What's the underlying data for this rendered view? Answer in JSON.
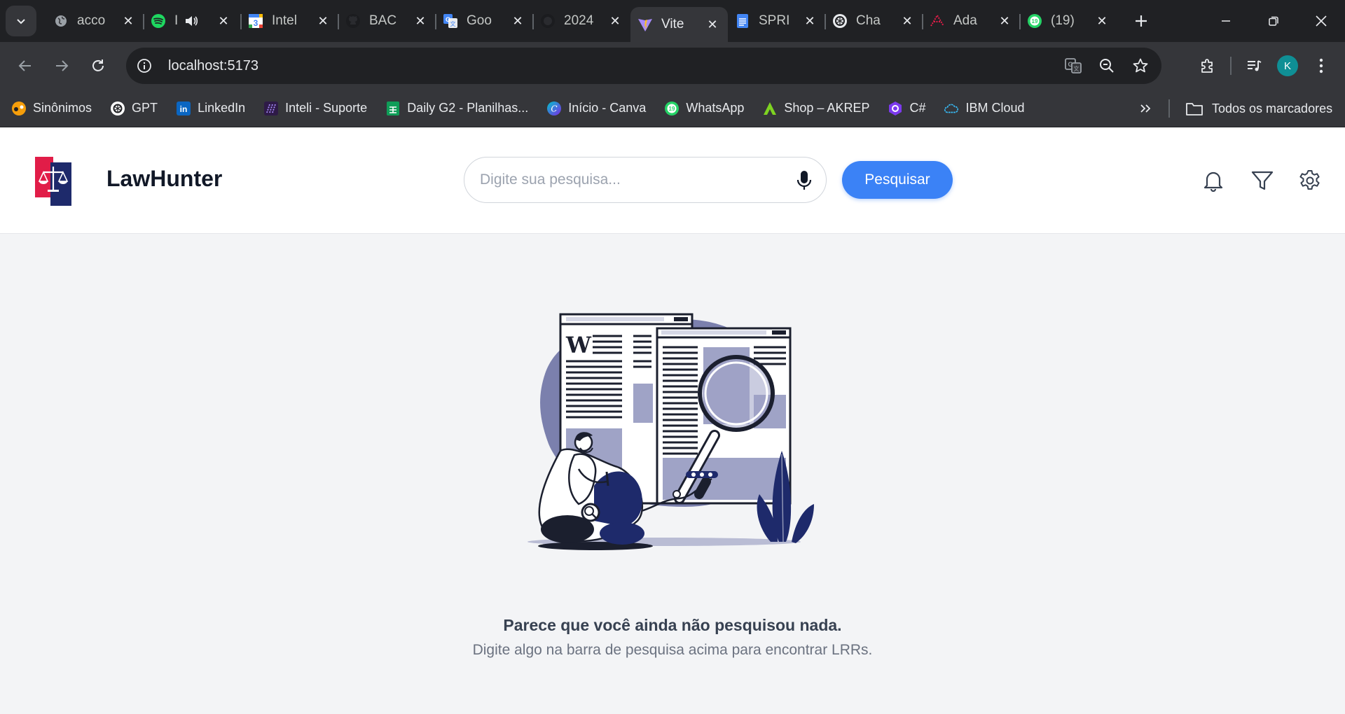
{
  "browser": {
    "tabs": [
      {
        "title": "acco",
        "icon": "globe-icon",
        "active": false
      },
      {
        "title": "I",
        "icon": "spotify-icon",
        "active": false,
        "audio": true
      },
      {
        "title": "Intel",
        "icon": "calendar-icon",
        "active": false
      },
      {
        "title": "BAC",
        "icon": "github-icon",
        "active": false
      },
      {
        "title": "Goo",
        "icon": "google-translate-icon",
        "active": false
      },
      {
        "title": "2024",
        "icon": "github-icon",
        "active": false
      },
      {
        "title": "Vite",
        "icon": "vite-icon",
        "active": true
      },
      {
        "title": "SPRI",
        "icon": "docs-icon",
        "active": false
      },
      {
        "title": "Cha",
        "icon": "chatgpt-icon",
        "active": false
      },
      {
        "title": "Ada",
        "icon": "ada-icon",
        "active": false
      },
      {
        "title": "(19)",
        "icon": "whatsapp-icon",
        "active": false
      }
    ],
    "url": "localhost:5173",
    "profile_initial": "K",
    "bookmarks": [
      {
        "label": "Sinônimos",
        "icon": "sinonimos-icon"
      },
      {
        "label": "GPT",
        "icon": "chatgpt-icon"
      },
      {
        "label": "LinkedIn",
        "icon": "linkedin-icon"
      },
      {
        "label": "Inteli - Suporte",
        "icon": "inteli-icon"
      },
      {
        "label": "Daily G2 - Planilhas...",
        "icon": "sheets-icon"
      },
      {
        "label": "Início - Canva",
        "icon": "canva-icon"
      },
      {
        "label": "WhatsApp",
        "icon": "whatsapp-icon"
      },
      {
        "label": "Shop – AKREP",
        "icon": "akrep-icon"
      },
      {
        "label": "C#",
        "icon": "csharp-icon"
      },
      {
        "label": "IBM Cloud",
        "icon": "ibm-cloud-icon"
      }
    ],
    "all_bookmarks_label": "Todos os marcadores"
  },
  "app": {
    "brand": "LawHunter",
    "search": {
      "placeholder": "Digite sua pesquisa...",
      "value": ""
    },
    "search_button": "Pesquisar",
    "empty_state": {
      "title": "Parece que você ainda não pesquisou nada.",
      "subtitle": "Digite algo na barra de pesquisa acima para encontrar LRRs.",
      "illustration": "person-searching-documents-illustration"
    }
  },
  "colors": {
    "primary": "#3b82f6",
    "illustration_navy": "#1e2a6b",
    "illustration_lavender": "#7b80ad"
  }
}
